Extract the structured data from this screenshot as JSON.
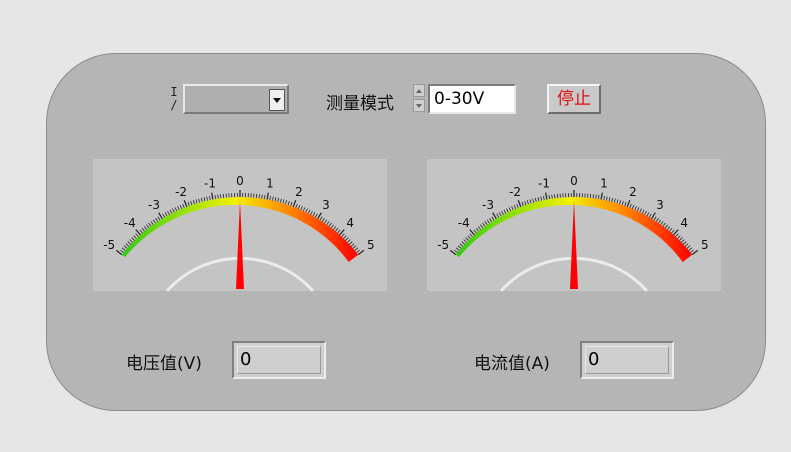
{
  "resource_selector": {
    "io_glyph": "I/O",
    "value": ""
  },
  "mode": {
    "label": "测量模式",
    "value": "0-30V"
  },
  "stop_button": {
    "label": "停止"
  },
  "meters": [
    {
      "id": "voltage-meter",
      "min": -5,
      "max": 5,
      "major_ticks": [
        "-5",
        "-4",
        "-3",
        "-2",
        "-1",
        "0",
        "1",
        "2",
        "3",
        "4",
        "5"
      ],
      "value": 0,
      "needle_color": "#ff0000"
    },
    {
      "id": "current-meter",
      "min": -5,
      "max": 5,
      "major_ticks": [
        "-5",
        "-4",
        "-3",
        "-2",
        "-1",
        "0",
        "1",
        "2",
        "3",
        "4",
        "5"
      ],
      "value": 0,
      "needle_color": "#ff0000"
    }
  ],
  "voltage": {
    "label": "电压值(V)",
    "value": "0"
  },
  "current": {
    "label": "电流值(A)",
    "value": "0"
  },
  "colors": {
    "scale_low": "#2ecc10",
    "scale_mid": "#f2f000",
    "scale_high": "#ff0000",
    "panel_bg": "#b5b5b5"
  }
}
